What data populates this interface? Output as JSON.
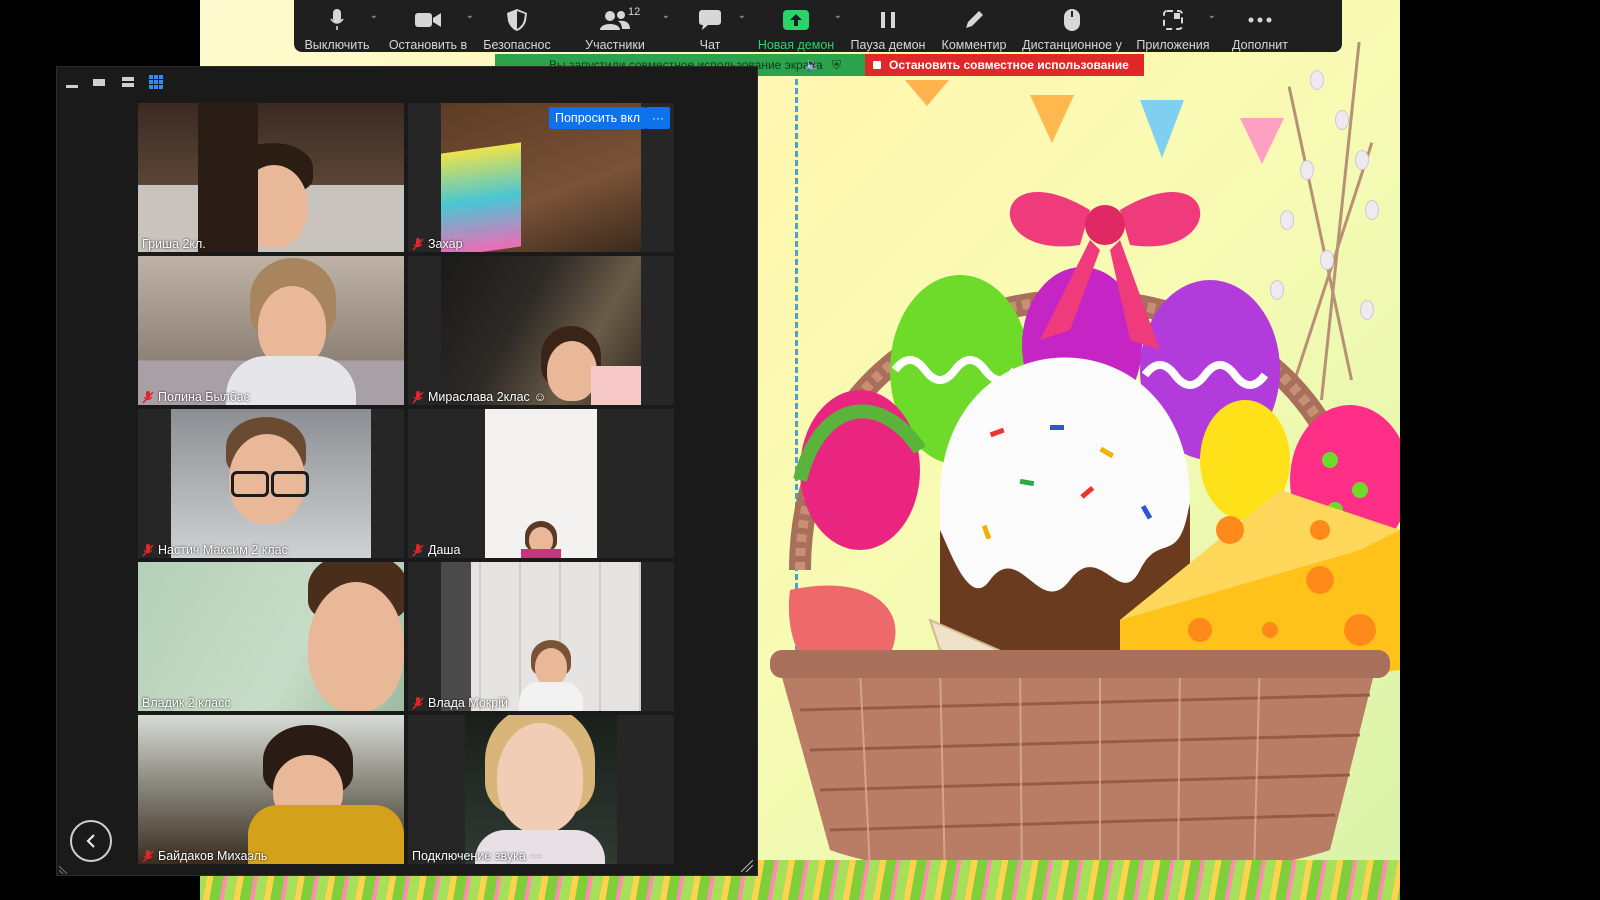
{
  "toolbar": {
    "items": [
      {
        "label": "Выключить",
        "icon": "microphone-icon"
      },
      {
        "label": "Остановить в",
        "icon": "video-camera-icon"
      },
      {
        "label": "Безопаснос",
        "icon": "security-shield-icon"
      },
      {
        "label": "Участники",
        "icon": "participants-icon",
        "count": "12"
      },
      {
        "label": "Чат",
        "icon": "chat-icon"
      },
      {
        "label": "Новая демон",
        "icon": "share-screen-icon"
      },
      {
        "label": "Пауза демон",
        "icon": "pause-icon"
      },
      {
        "label": "Комментир",
        "icon": "pencil-icon"
      },
      {
        "label": "Дистанционное у",
        "icon": "mouse-icon"
      },
      {
        "label": "Приложения",
        "icon": "apps-icon"
      },
      {
        "label": "Дополнит",
        "icon": "more-icon"
      }
    ],
    "accent_color": "#2bd46a"
  },
  "share_banner": {
    "text": "Вы запустили совместное использование экрана",
    "stop_label": "Остановить совместное использование",
    "banner_color": "#2ba24c",
    "stop_color": "#e02828"
  },
  "gallery": {
    "ask_unmute": "Попросить вкл",
    "more": "···",
    "participants": [
      {
        "name": "Гриша 2кл.",
        "muted": false
      },
      {
        "name": "Захар",
        "muted": true
      },
      {
        "name": "Полина Былбас",
        "muted": true
      },
      {
        "name": "Мираслава 2клас",
        "muted": true
      },
      {
        "name": "Настич Максим 2 клас",
        "muted": true
      },
      {
        "name": "Даша",
        "muted": true
      },
      {
        "name": "Владик 2 класс",
        "muted": false
      },
      {
        "name": "Влада Мокрій",
        "muted": true
      },
      {
        "name": "Байдаков Михаэль",
        "muted": true
      },
      {
        "name": "Подключение звука",
        "muted": false
      }
    ]
  }
}
